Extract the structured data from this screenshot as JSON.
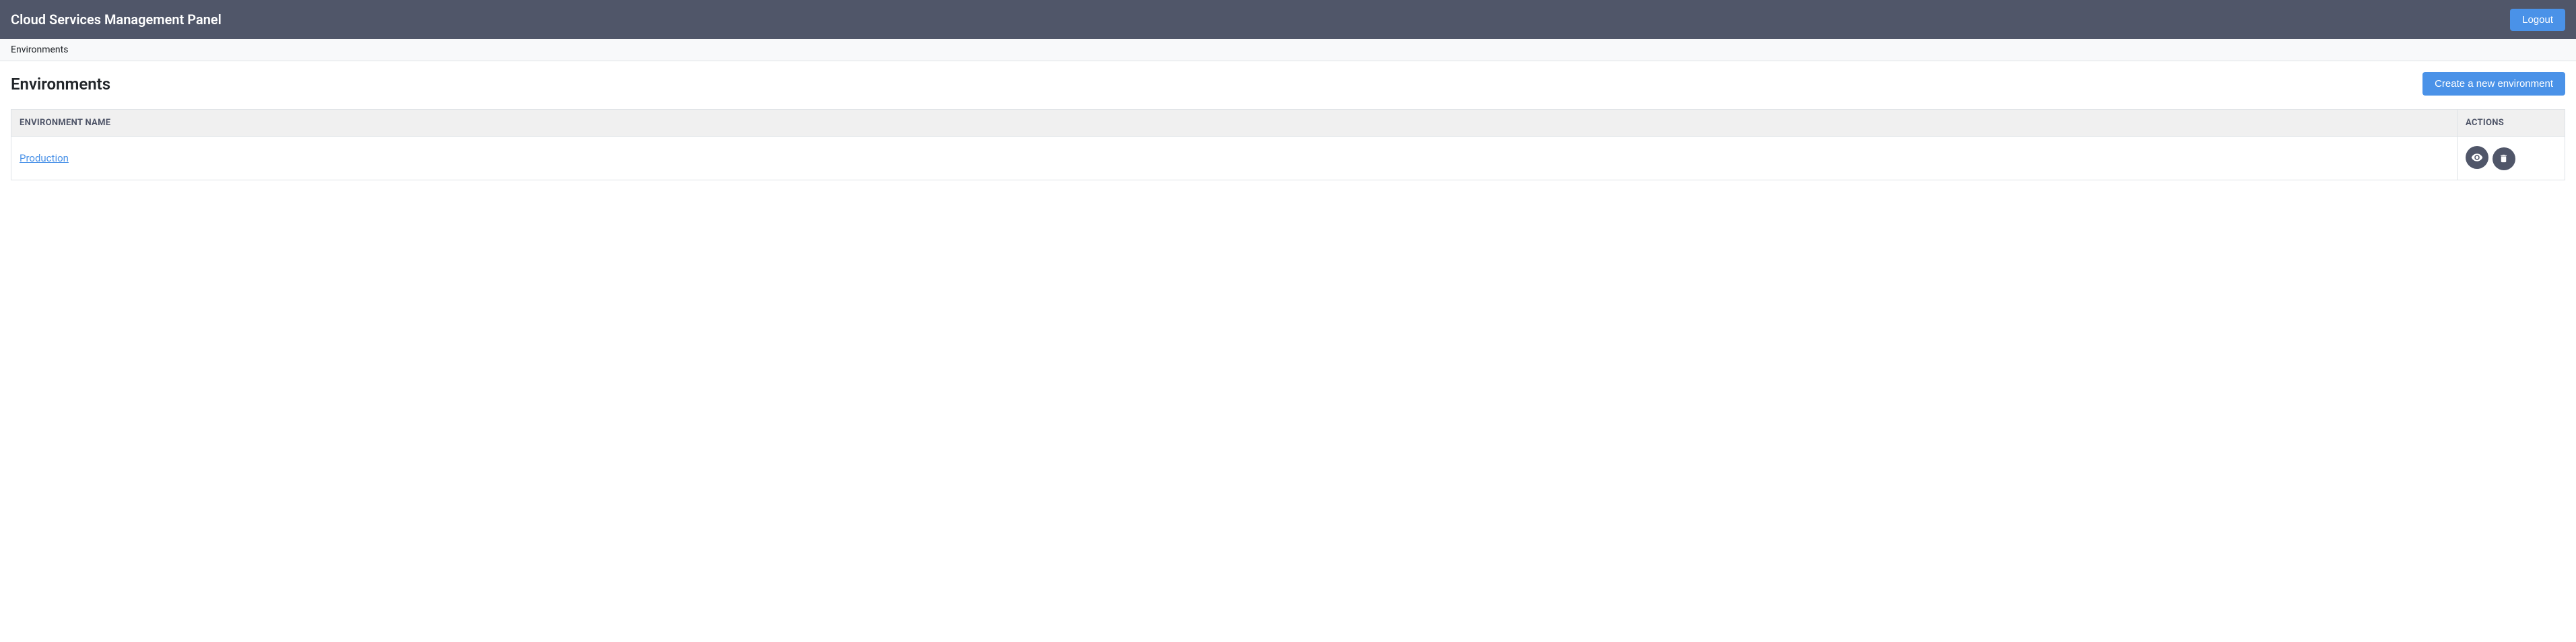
{
  "header": {
    "title": "Cloud Services Management Panel",
    "logout_label": "Logout"
  },
  "breadcrumb": {
    "current": "Environments"
  },
  "page": {
    "title": "Environments",
    "create_button_label": "Create a new environment"
  },
  "table": {
    "columns": {
      "name": "Environment Name",
      "actions": "Actions"
    },
    "rows": [
      {
        "name": "Production"
      }
    ]
  },
  "icons": {
    "view": "eye-icon",
    "delete": "trash-icon"
  }
}
